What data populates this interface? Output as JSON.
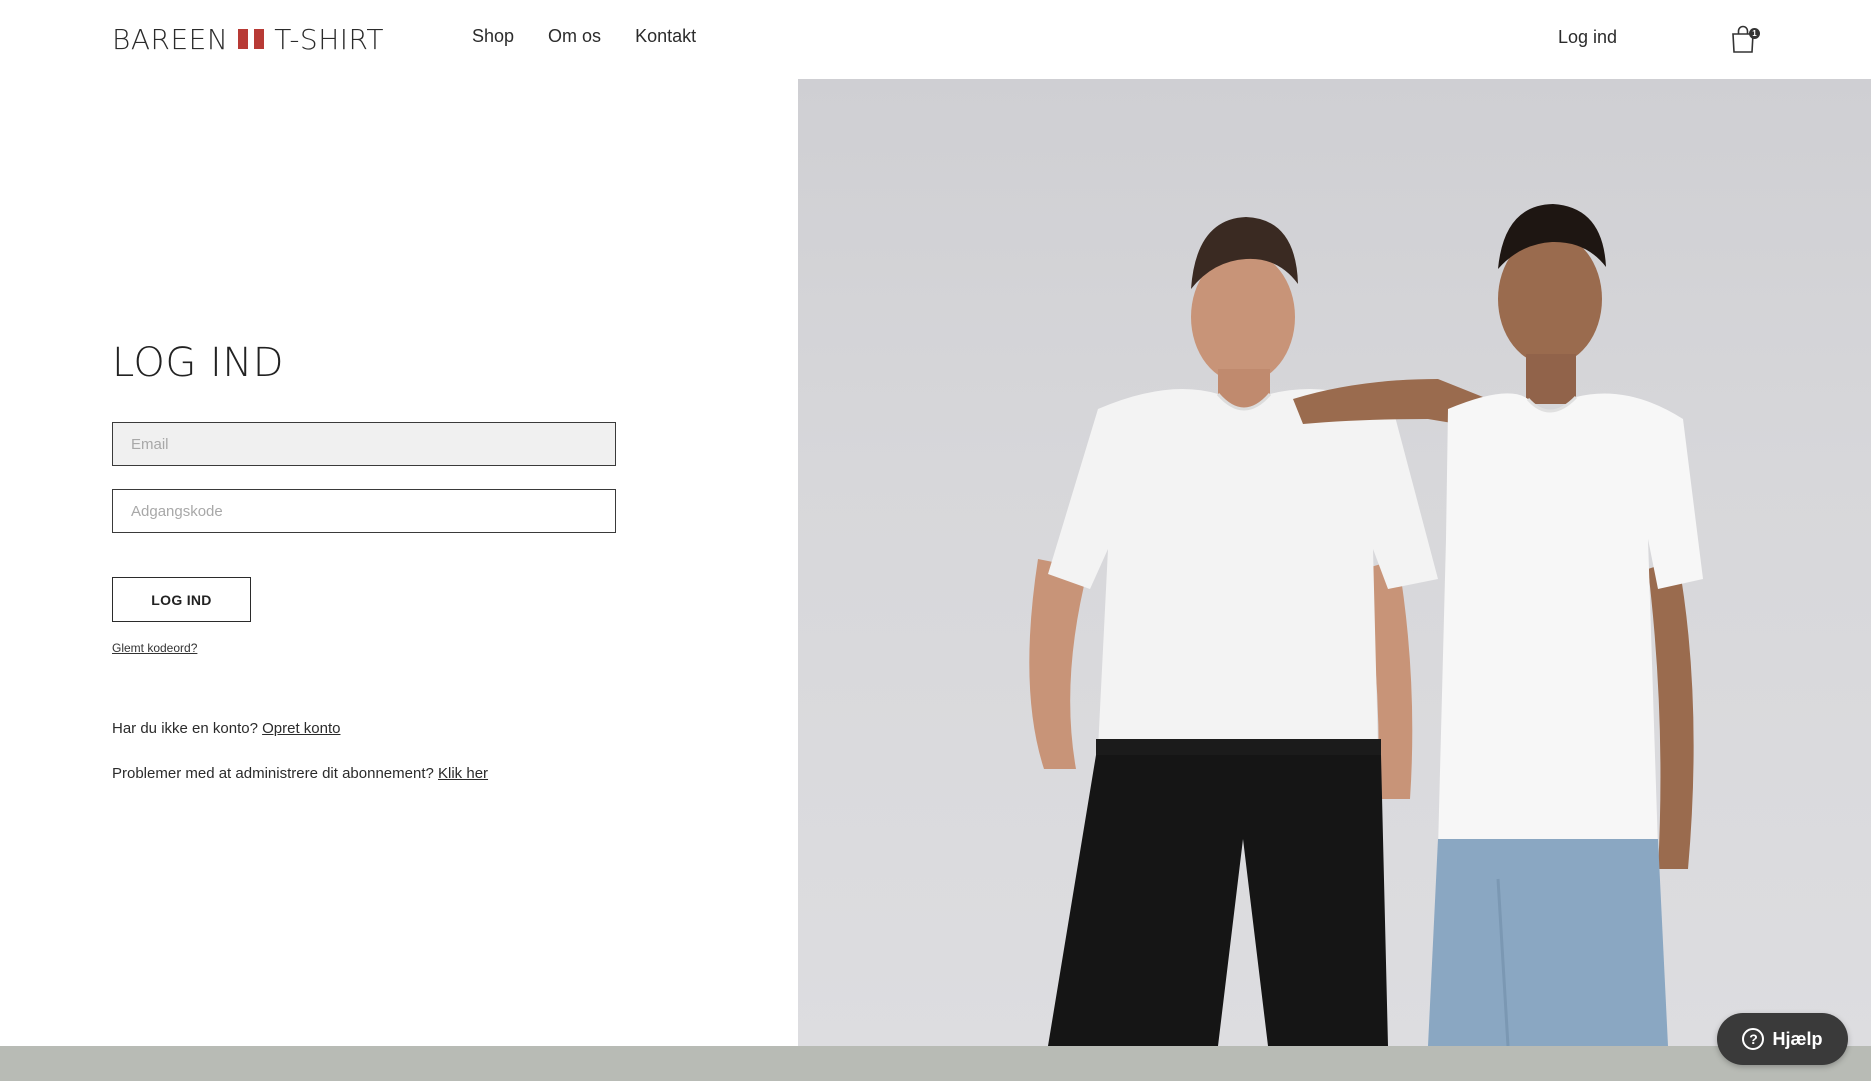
{
  "brand": {
    "left_text": "BAREEN",
    "right_text": "T-SHIRT",
    "flag_colors": [
      "#b83a35",
      "#b83a35"
    ]
  },
  "nav": {
    "items": [
      {
        "label": "Shop"
      },
      {
        "label": "Om os"
      },
      {
        "label": "Kontakt"
      }
    ],
    "login_label": "Log ind",
    "cart_count": "1"
  },
  "login": {
    "title": "LOG IND",
    "email_placeholder": "Email",
    "password_placeholder": "Adgangskode",
    "submit_label": "LOG IND",
    "forgot_label": "Glemt kodeord?",
    "no_account_text": "Har du ikke en konto?",
    "create_account_label": "Opret konto",
    "subscription_text": "Problemer med at administrere dit abonnement?",
    "subscription_link_label": "Klik her"
  },
  "help": {
    "label": "Hjælp"
  },
  "colors": {
    "accent_red": "#b83a35",
    "footer_strip": "#b8bbb5",
    "help_button": "#3a3a3a"
  }
}
